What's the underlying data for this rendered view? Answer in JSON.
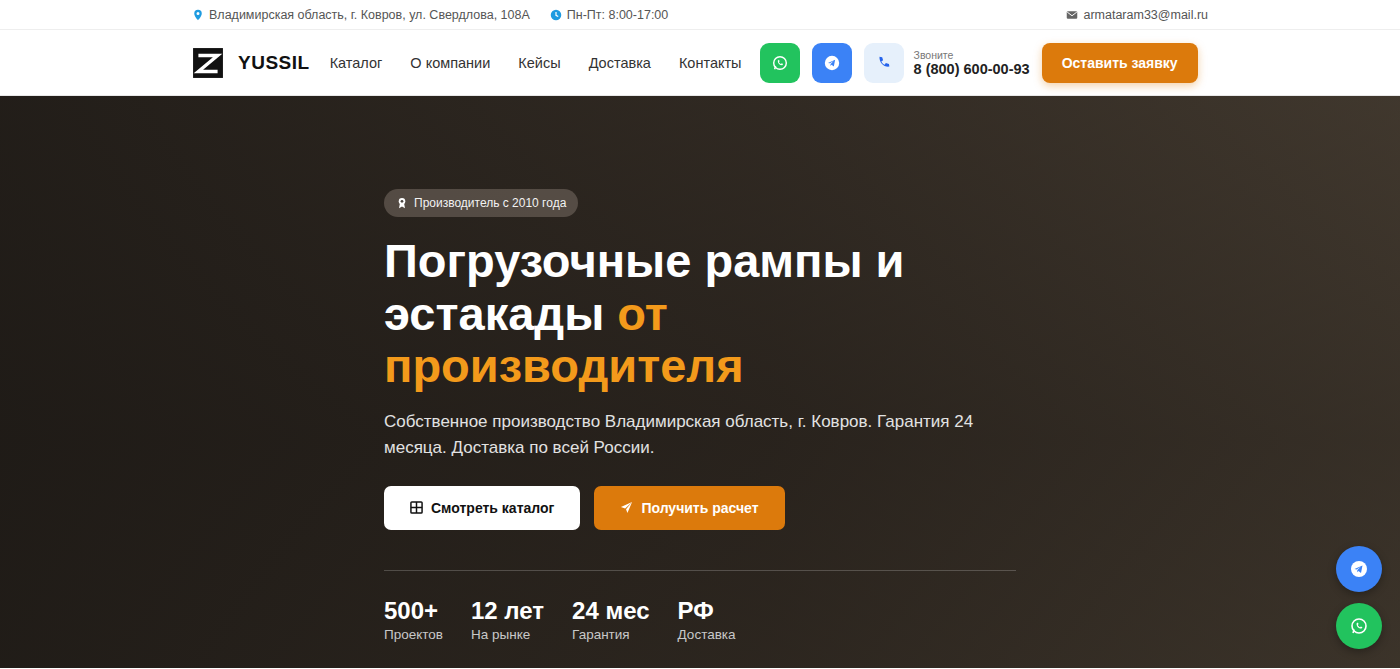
{
  "topbar": {
    "address": "Владимирская область, г. Ковров, ул. Свердлова, 108А",
    "hours": "Пн-Пт: 8:00-17:00",
    "email": "armataram33@mail.ru"
  },
  "header": {
    "logo": "YUSSIL",
    "nav": [
      "Каталог",
      "О компании",
      "Кейсы",
      "Доставка",
      "Контакты"
    ],
    "phone_label": "Звоните",
    "phone": "8 (800) 600-00-93",
    "cta": "Оставить заявку"
  },
  "hero": {
    "badge": "Производитель с 2010 года",
    "title": "Погрузочные рампы и эстакады",
    "title_accent": "от производителя",
    "subtitle": "Собственное производство Владимирская область, г. Ковров. Гарантия 24 месяца. Доставка по всей России.",
    "buttons": [
      {
        "label": "Смотреть каталог",
        "kind": "secondary"
      },
      {
        "label": "Получить расчет",
        "kind": "primary"
      }
    ],
    "stats": [
      {
        "value": "500+",
        "label": "Проектов"
      },
      {
        "value": "12 лет",
        "label": "На рынке"
      },
      {
        "value": "24 мес",
        "label": "Гарантия"
      },
      {
        "value": "РФ",
        "label": "Доставка"
      }
    ]
  }
}
